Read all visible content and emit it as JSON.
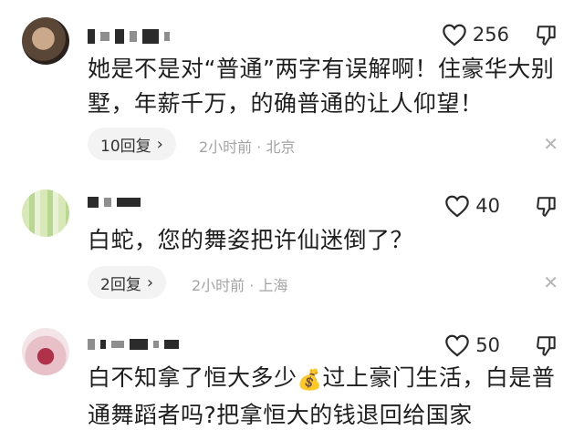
{
  "comments": [
    {
      "likes": "256",
      "text": "她是不是对“普通”两字有误解啊！住豪华大别墅，年薪千万，的确普通的让人仰望！",
      "replies": "10回复",
      "meta": "2小时前 · 北京"
    },
    {
      "likes": "40",
      "text": "白蛇，您的舞姿把许仙迷倒了？",
      "replies": "2回复",
      "meta": "2小时前 · 上海"
    },
    {
      "likes": "50",
      "text_before": "白不知拿了恒大多少",
      "emoji": "💰",
      "text_after": "过上豪门生活，白是普通舞蹈者吗?把拿恒大的钱退回给国家"
    }
  ],
  "icons": {
    "like": "heart-outline-icon",
    "dislike": "thumbs-down-outline-icon",
    "close": "close-icon",
    "chevron": "chevron-right-icon"
  },
  "colors": {
    "text": "#1e1e1e",
    "meta": "#a3a3a3",
    "reply_pill": "#f3f3f3"
  }
}
